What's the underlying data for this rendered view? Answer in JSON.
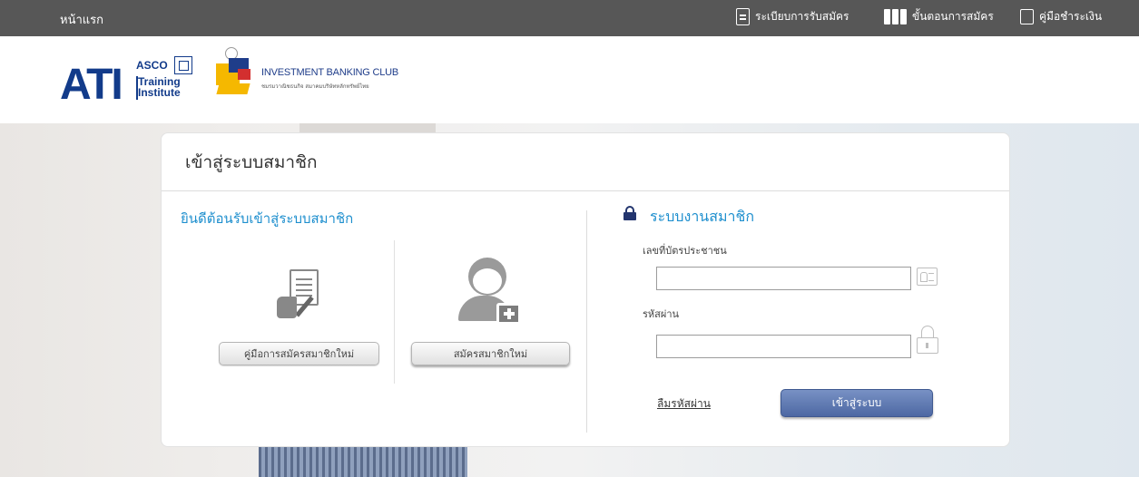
{
  "topbar": {
    "home": "หน้าแรก",
    "nav": [
      {
        "label": "ระเบียบการรับสมัคร",
        "icon": "document-icon"
      },
      {
        "label": "ขั้นตอนการสมัคร",
        "icon": "steps-icon"
      },
      {
        "label": "คู่มือชำระเงิน",
        "icon": "payment-guide-icon"
      }
    ],
    "background": "#575757"
  },
  "logos": {
    "ati_mark": "ATI",
    "asco_line1": "ASCO",
    "asco_line2": "Training",
    "asco_line3": "Institute",
    "ibc_name": "INVESTMENT BANKING CLUB",
    "ibc_sub": "ชมรมวาณิชธนกิจ สมาคมบริษัทหลักทรัพย์ไทย"
  },
  "card": {
    "title": "เข้าสู่ระบบสมาชิก",
    "welcome": "ยินดีต้อนรับเข้าสู่ระบบสมาชิก",
    "manual_button": "คู่มือการสมัครสมาชิกใหม่",
    "register_button": "สมัครสมาชิกใหม่",
    "member_title": "ระบบงานสมาชิก",
    "id_label": "เลขที่บัตรประชาชน",
    "id_value": "",
    "password_label": "รหัสผ่าน",
    "password_value": "",
    "forgot_link": "ลืมรหัสผ่าน",
    "login_button": "เข้าสู่ระบบ"
  },
  "colors": {
    "accent_blue": "#1e8fce",
    "login_button": "#5a74ad",
    "brand_navy": "#123b8a"
  }
}
